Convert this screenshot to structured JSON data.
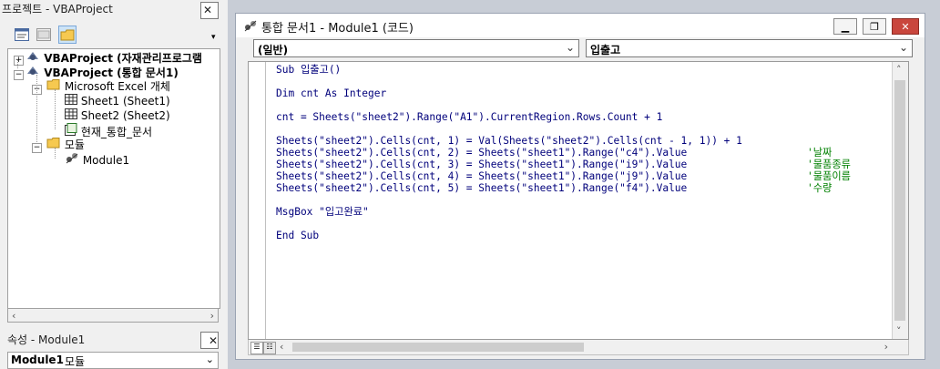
{
  "project": {
    "title": "프로젝트 - VBAProject",
    "tree": [
      {
        "label": "VBAProject (자재관리프로그램",
        "bold": true,
        "expander": "+"
      },
      {
        "label": "VBAProject (통합 문서1)",
        "bold": true,
        "expander": "−"
      },
      {
        "label": "Microsoft Excel 개체",
        "bold": false,
        "expander": "−"
      },
      {
        "label": "Sheet1 (Sheet1)",
        "bold": false
      },
      {
        "label": "Sheet2 (Sheet2)",
        "bold": false
      },
      {
        "label": "현재_통합_문서",
        "bold": false
      },
      {
        "label": "모듈",
        "bold": false,
        "expander": "−"
      },
      {
        "label": "Module1",
        "bold": false
      }
    ]
  },
  "properties": {
    "title": "속성 - Module1",
    "object_name": "Module1",
    "object_type": "모듈"
  },
  "codewin": {
    "title": "통합 문서1 - Module1 (코드)",
    "object_combo": "(일반)",
    "proc_combo": "입출고",
    "lines": [
      "Sub 입출고()",
      "",
      "Dim cnt As Integer",
      "",
      "cnt = Sheets(\"sheet2\").Range(\"A1\").CurrentRegion.Rows.Count + 1",
      "",
      "Sheets(\"sheet2\").Cells(cnt, 1) = Val(Sheets(\"sheet2\").Cells(cnt - 1, 1)) + 1",
      "Sheets(\"sheet2\").Cells(cnt, 2) = Sheets(\"sheet1\").Range(\"c4\").Value",
      "Sheets(\"sheet2\").Cells(cnt, 3) = Sheets(\"sheet1\").Range(\"i9\").Value",
      "Sheets(\"sheet2\").Cells(cnt, 4) = Sheets(\"sheet1\").Range(\"j9\").Value",
      "Sheets(\"sheet2\").Cells(cnt, 5) = Sheets(\"sheet1\").Range(\"f4\").Value",
      "",
      "MsgBox \"입고완료\"",
      "",
      "End Sub"
    ],
    "comments": {
      "7": "'날짜",
      "8": "'물품종류",
      "9": "'물품이름",
      "10": "'수량"
    }
  }
}
